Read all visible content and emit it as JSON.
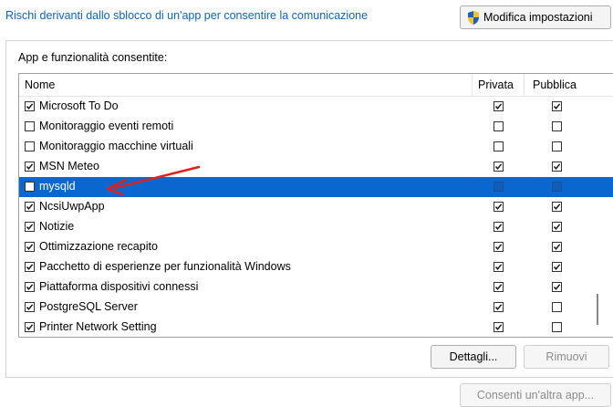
{
  "header": {
    "risk_link": "Rischi derivanti dallo sblocco di un'app per consentire la comunicazione",
    "modify_button": "Modifica impostazioni"
  },
  "group": {
    "label": "App e funzionalità consentite:"
  },
  "table": {
    "columns": {
      "name": "Nome",
      "private": "Privata",
      "public": "Pubblica"
    },
    "rows": [
      {
        "name": "Microsoft To Do",
        "enabled": true,
        "private": true,
        "public": true
      },
      {
        "name": "Monitoraggio eventi remoti",
        "enabled": false,
        "private": false,
        "public": false
      },
      {
        "name": "Monitoraggio macchine virtuali",
        "enabled": false,
        "private": false,
        "public": false
      },
      {
        "name": "MSN Meteo",
        "enabled": true,
        "private": true,
        "public": true
      },
      {
        "name": "mysqld",
        "enabled": true,
        "private": false,
        "public": false,
        "selected": true
      },
      {
        "name": "NcsiUwpApp",
        "enabled": true,
        "private": true,
        "public": true
      },
      {
        "name": "Notizie",
        "enabled": true,
        "private": true,
        "public": true
      },
      {
        "name": "Ottimizzazione recapito",
        "enabled": true,
        "private": true,
        "public": true
      },
      {
        "name": "Pacchetto di esperienze per funzionalità Windows",
        "enabled": true,
        "private": true,
        "public": true
      },
      {
        "name": "Piattaforma dispositivi connessi",
        "enabled": true,
        "private": true,
        "public": true
      },
      {
        "name": "PostgreSQL Server",
        "enabled": true,
        "private": true,
        "public": false
      },
      {
        "name": "Printer Network Setting",
        "enabled": true,
        "private": true,
        "public": false
      }
    ]
  },
  "buttons": {
    "details": "Dettagli...",
    "remove": "Rimuovi",
    "allow_other": "Consenti un'altra app..."
  },
  "colors": {
    "link": "#0b63c4",
    "selection": "#0a67d0",
    "annotation_arrow": "#e0201b"
  },
  "icons": {
    "modify_button_icon": "uac-shield-icon",
    "annotation": "red-arrow-icon"
  }
}
